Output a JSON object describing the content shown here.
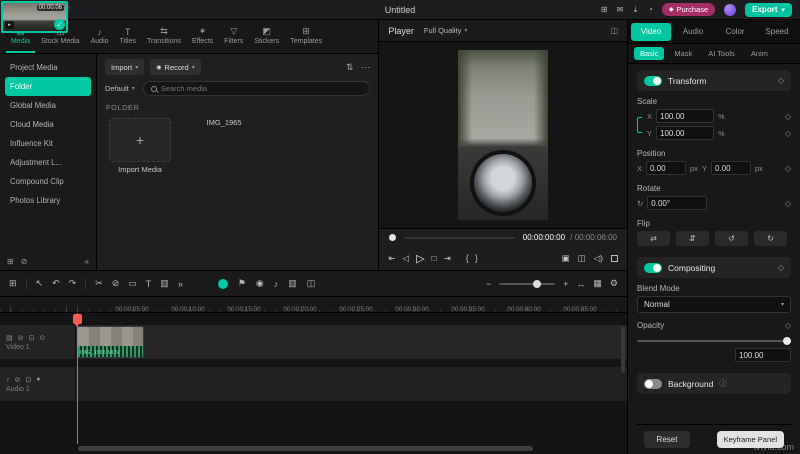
{
  "titlebar": {
    "title": "Untitled",
    "purchase": "Purchase",
    "export": "Export"
  },
  "icons": {
    "caret": "▾",
    "ellipsis": "⋯",
    "sort": "⇅",
    "plus": "+",
    "check": "✓",
    "record": "◉",
    "collapse": "«",
    "new_folder": "⊞",
    "delete_folder": "⊘",
    "gem": "◆",
    "tab_media": "▤",
    "tab_stock": "◫",
    "tab_audio": "♪",
    "tab_titles": "T",
    "tab_transitions": "⇆",
    "tab_effects": "✶",
    "tab_filters": "▽",
    "tab_stickers": "◩",
    "tab_templates": "⊞",
    "grid": "⊞",
    "message": "✉",
    "download": "⇣",
    "bell": "◔",
    "pip": "◫",
    "jump_start": "⇤",
    "prev_frame": "◁",
    "play": "▷",
    "stop": "□",
    "next_frame": "⇥",
    "mark_in": "{",
    "mark_out": "}",
    "snapshot": "▣",
    "compare": "◫",
    "volume": "◁)",
    "tl_menu": "⊞",
    "pointer": "↖",
    "undo": "↶",
    "redo": "↷",
    "split": "✂",
    "delete": "⊘",
    "crop": "▭",
    "title_tool": "T",
    "screen": "▥",
    "more": "»",
    "flag": "⚑",
    "mic": "◉",
    "note": "♪",
    "zoom_out": "−",
    "zoom_in": "+",
    "fit": "↔",
    "tracks": "▦",
    "settings": "⚙",
    "diamond": "◇",
    "rotate": "↻",
    "flip_h": "⇄",
    "flip_v": "⇵",
    "rotate_ccw": "↺",
    "rotate_cw": "↻",
    "info": "ⓘ",
    "film": "▤",
    "eye": "⊙",
    "lock": "⊡",
    "mute": "⊘",
    "dot": "●",
    "video_badge": "▸"
  },
  "media_tabs": {
    "items": [
      {
        "label": "Media"
      },
      {
        "label": "Stock Media"
      },
      {
        "label": "Audio"
      },
      {
        "label": "Titles"
      },
      {
        "label": "Transitions"
      },
      {
        "label": "Effects"
      },
      {
        "label": "Filters"
      },
      {
        "label": "Stickers"
      },
      {
        "label": "Templates"
      }
    ]
  },
  "sidebar": {
    "items": [
      "Project Media",
      "Folder",
      "Global Media",
      "Cloud Media",
      "Influence Kit",
      "Adjustment L...",
      "Compound Clip",
      "Photos Library"
    ]
  },
  "media": {
    "import_label": "Import",
    "record_label": "Record",
    "filter_label": "Default",
    "search_placeholder": "Search media",
    "section_label": "FOLDER",
    "import_tile_label": "Import Media",
    "clip_name": "IMG_1965",
    "clip_duration": "00:00:06"
  },
  "player": {
    "label": "Player",
    "quality": "Full Quality",
    "current_time": "00:00:00:00",
    "total_time": "/ 00:00:06:00"
  },
  "properties": {
    "tabs": [
      "Video",
      "Audio",
      "Color",
      "Speed"
    ],
    "subtabs": [
      "Basic",
      "Mask",
      "AI Tools",
      "Anim"
    ],
    "transform": {
      "title": "Transform",
      "scale": "Scale",
      "x": "X",
      "y": "Y",
      "scale_x": "100.00",
      "scale_y": "100.00",
      "pct": "%",
      "position": "Position",
      "pos_x": "0.00",
      "pos_y": "0.00",
      "px": "px",
      "rotate": "Rotate",
      "rotate_value": "0.00°",
      "flip": "Flip"
    },
    "compositing": {
      "title": "Compositing",
      "blend_label": "Blend Mode",
      "blend_value": "Normal",
      "opacity_label": "Opacity",
      "opacity_value": "100.00"
    },
    "background": {
      "title": "Background"
    },
    "footer": {
      "reset": "Reset",
      "keyframe": "Keyframe Panel"
    }
  },
  "timeline": {
    "ruler": [
      "00:00:05:00",
      "00:00:10:00",
      "00:00:15:00",
      "00:00:20:00",
      "00:00:25:00",
      "00:00:30:00",
      "00:00:35:00",
      "00:00:40:00",
      "00:00:45:00"
    ],
    "video_track": "Video 1",
    "audio_track": "Audio 1",
    "clip_label": "IMG_1965.MOV"
  },
  "watermark": "ivtvid.com"
}
